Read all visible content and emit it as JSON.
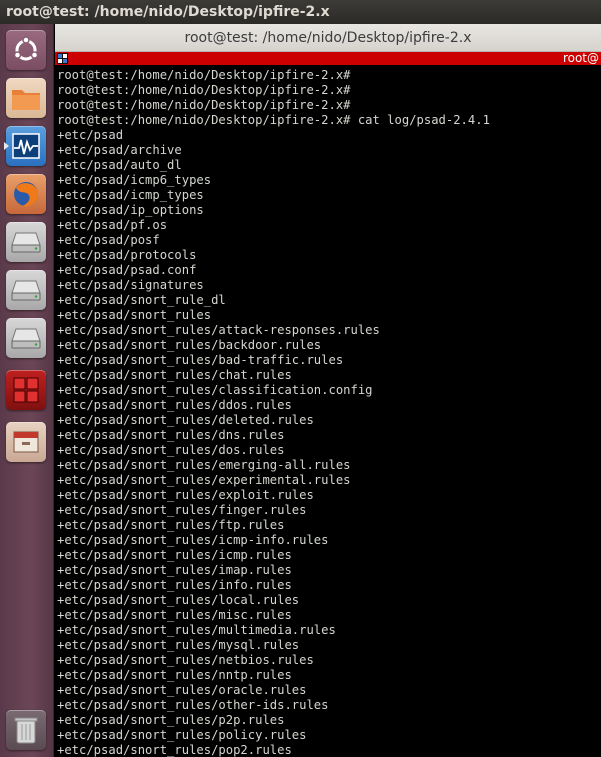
{
  "top_panel": {
    "title": "root@test: /home/nido/Desktop/ipfire-2.x"
  },
  "launcher": {
    "items": [
      {
        "name": "dash-home",
        "icon": "ubuntu-logo-icon"
      },
      {
        "name": "files",
        "icon": "folder-icon"
      },
      {
        "name": "system-monitor",
        "icon": "system-monitor-icon"
      },
      {
        "name": "firefox",
        "icon": "firefox-icon"
      },
      {
        "name": "drive-1",
        "icon": "hard-drive-icon"
      },
      {
        "name": "drive-2",
        "icon": "hard-drive-icon"
      },
      {
        "name": "drive-3",
        "icon": "hard-drive-icon"
      },
      {
        "name": "workspace-switcher",
        "icon": "workspace-switcher-icon"
      },
      {
        "name": "file-manager",
        "icon": "file-cabinet-icon"
      },
      {
        "name": "trash",
        "icon": "trash-icon"
      }
    ]
  },
  "terminal": {
    "window_title": "root@test: /home/nido/Desktop/ipfire-2.x",
    "tab_label": "root@",
    "lines": [
      "root@test:/home/nido/Desktop/ipfire-2.x#",
      "root@test:/home/nido/Desktop/ipfire-2.x#",
      "root@test:/home/nido/Desktop/ipfire-2.x#",
      "root@test:/home/nido/Desktop/ipfire-2.x# cat log/psad-2.4.1",
      "+etc/psad",
      "+etc/psad/archive",
      "+etc/psad/auto_dl",
      "+etc/psad/icmp6_types",
      "+etc/psad/icmp_types",
      "+etc/psad/ip_options",
      "+etc/psad/pf.os",
      "+etc/psad/posf",
      "+etc/psad/protocols",
      "+etc/psad/psad.conf",
      "+etc/psad/signatures",
      "+etc/psad/snort_rule_dl",
      "+etc/psad/snort_rules",
      "+etc/psad/snort_rules/attack-responses.rules",
      "+etc/psad/snort_rules/backdoor.rules",
      "+etc/psad/snort_rules/bad-traffic.rules",
      "+etc/psad/snort_rules/chat.rules",
      "+etc/psad/snort_rules/classification.config",
      "+etc/psad/snort_rules/ddos.rules",
      "+etc/psad/snort_rules/deleted.rules",
      "+etc/psad/snort_rules/dns.rules",
      "+etc/psad/snort_rules/dos.rules",
      "+etc/psad/snort_rules/emerging-all.rules",
      "+etc/psad/snort_rules/experimental.rules",
      "+etc/psad/snort_rules/exploit.rules",
      "+etc/psad/snort_rules/finger.rules",
      "+etc/psad/snort_rules/ftp.rules",
      "+etc/psad/snort_rules/icmp-info.rules",
      "+etc/psad/snort_rules/icmp.rules",
      "+etc/psad/snort_rules/imap.rules",
      "+etc/psad/snort_rules/info.rules",
      "+etc/psad/snort_rules/local.rules",
      "+etc/psad/snort_rules/misc.rules",
      "+etc/psad/snort_rules/multimedia.rules",
      "+etc/psad/snort_rules/mysql.rules",
      "+etc/psad/snort_rules/netbios.rules",
      "+etc/psad/snort_rules/nntp.rules",
      "+etc/psad/snort_rules/oracle.rules",
      "+etc/psad/snort_rules/other-ids.rules",
      "+etc/psad/snort_rules/p2p.rules",
      "+etc/psad/snort_rules/policy.rules",
      "+etc/psad/snort_rules/pop2.rules"
    ]
  },
  "colors": {
    "terminal_bg": "#000000",
    "terminal_fg": "#d3d7cf",
    "tab_bar": "#cc0000",
    "launcher_bg": "#6b4656"
  }
}
